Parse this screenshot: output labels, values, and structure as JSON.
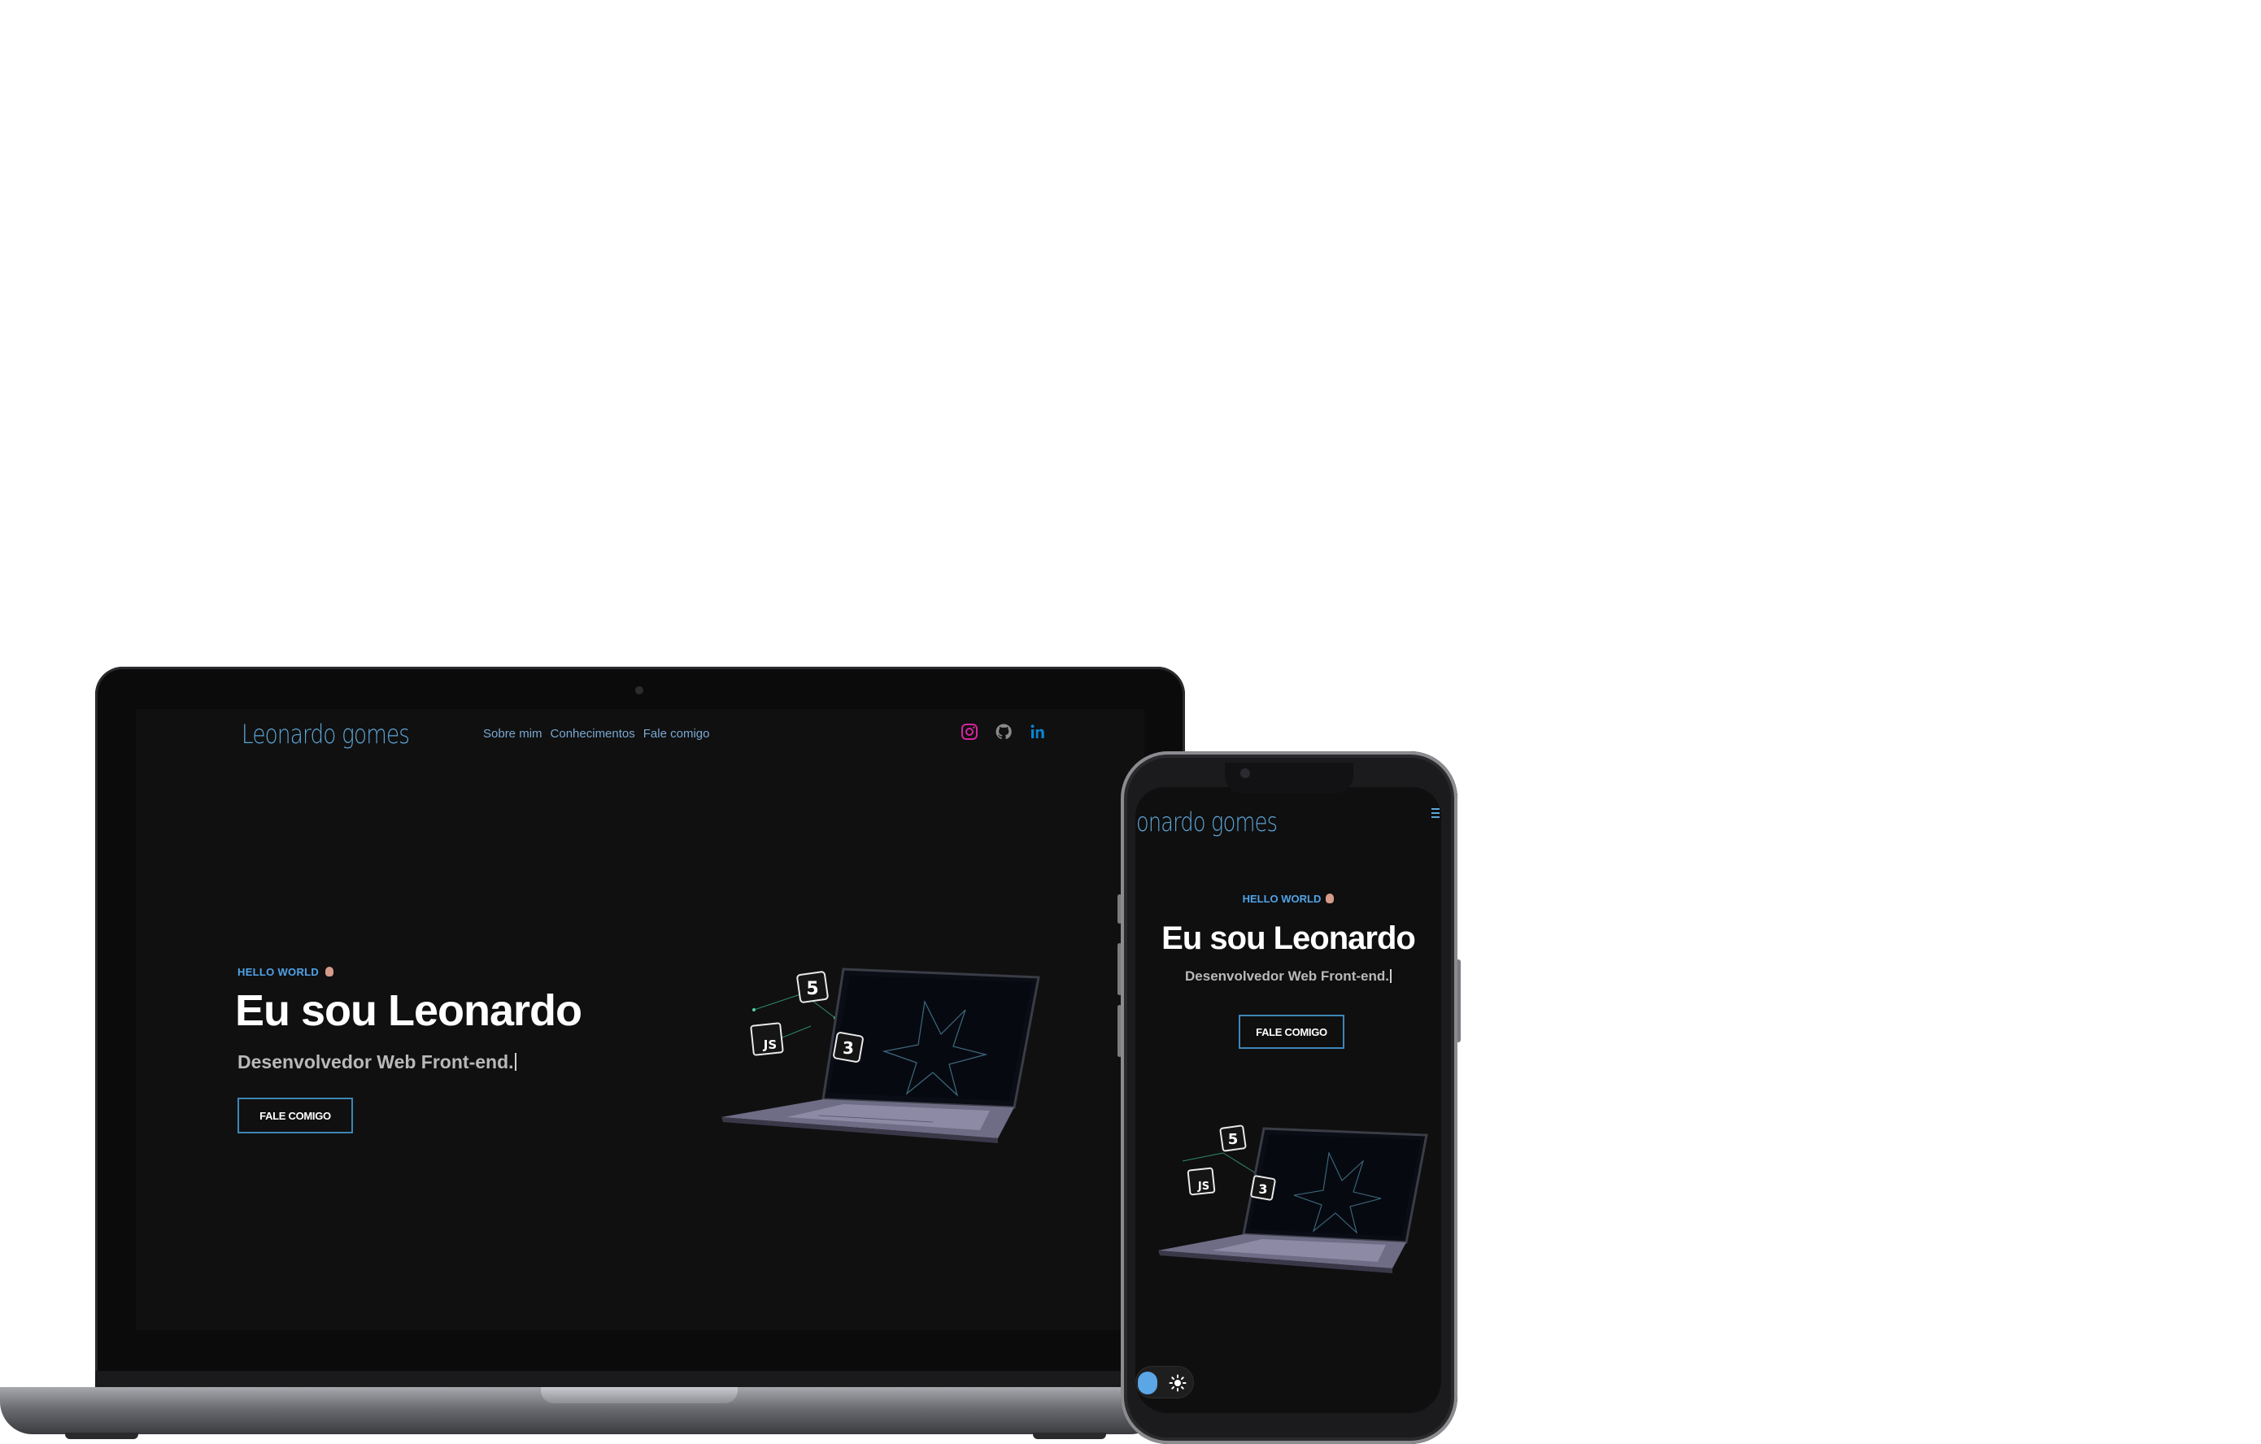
{
  "site": {
    "logo": "Leonardo gomes",
    "nav": [
      "Sobre mim",
      "Conhecimentos",
      "Fale comigo"
    ],
    "social_icons": [
      "instagram-icon",
      "github-icon",
      "linkedin-icon"
    ],
    "hello": "HELLO WORLD",
    "title": "Eu sou Leonardo",
    "subtitle": "Desenvolvedor Web Front-end.",
    "cta": "FALE COMIGO"
  },
  "phone": {
    "logo": "eonardo gomes"
  },
  "illustration_badges": [
    "5",
    "3",
    "JS"
  ],
  "colors": {
    "background_page": "#ffffff",
    "site_background": "#101010",
    "accent_blue": "#4fa3e8",
    "logo_blue": "#5ea6d8",
    "instagram": "#d6249f",
    "github": "#8a8a8a",
    "linkedin": "#0a84d0"
  }
}
